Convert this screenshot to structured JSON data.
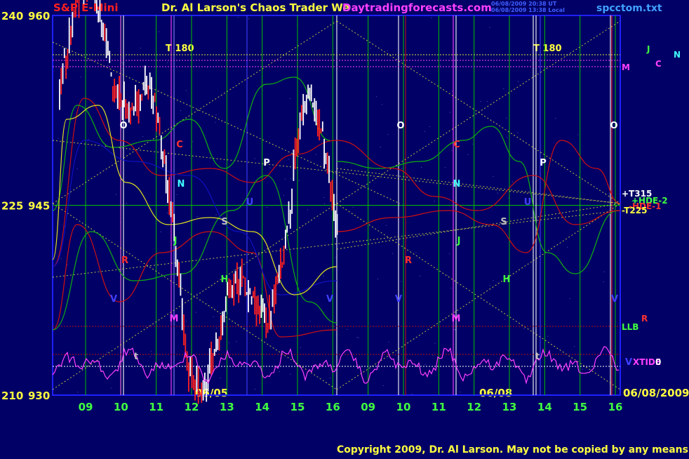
{
  "header": {
    "title_left": "S&P E-Mini",
    "title_center": "Dr. Al Larson's Chaos Trader We",
    "site": "Daytradingforecasts.com",
    "timestamp_1": "06/08/2009 20:38 UT",
    "timestamp_2": "06/08/2009 13:38 Local",
    "filename": "spcctom.txt"
  },
  "footer": {
    "copyright": "Copyright 2009, Dr. Al Larson. May not be copied by any means."
  },
  "colors": {
    "background": "#000066",
    "frame": "#2020ff",
    "grid": "#00c000",
    "price_up": "#ffffff",
    "price_down": "#ff2020",
    "red_line": "#d01010",
    "green_line": "#10b010",
    "blue_line": "#1010c0",
    "yellow_dot": "#e0e040",
    "magenta_line": "#ff40ff",
    "dark_red_dot": "#a01010"
  },
  "chart_data": {
    "type": "line",
    "instrument": "S&P E-Mini",
    "left_axis_outer": [
      {
        "label": "240",
        "value": 960
      },
      {
        "label": "225",
        "value": 945
      },
      {
        "label": "210",
        "value": 930
      }
    ],
    "ylim": [
      930,
      960
    ],
    "x_ticks": [
      "09",
      "10",
      "11",
      "12",
      "13",
      "14",
      "15",
      "16",
      "09",
      "10",
      "11",
      "12",
      "13",
      "14",
      "15",
      "16"
    ],
    "date_labels": [
      "06/05",
      "06/08",
      "06/08/2009"
    ],
    "right_labels": [
      {
        "text": "+T315",
        "color": "#ffffff"
      },
      {
        "text": "+HDE-2",
        "color": "#40ff40"
      },
      {
        "text": "-HDE-1",
        "color": "#ff3030"
      },
      {
        "text": "-T225",
        "color": "#ffff40"
      },
      {
        "text": "LLB",
        "color": "#40ff40"
      },
      {
        "text": "R",
        "color": "#ff3030"
      },
      {
        "text": "XTIDE",
        "color": "#ff40ff"
      },
      {
        "text": "0",
        "color": "#ffffff"
      },
      {
        "text": "M",
        "color": "#ff40ff"
      },
      {
        "text": "J",
        "color": "#40ff40"
      },
      {
        "text": "C",
        "color": "#ff40ff"
      },
      {
        "text": "N",
        "color": "#40ffff"
      }
    ],
    "time_lines": [
      {
        "text": "T 180",
        "color": "#ffff40"
      },
      {
        "text": "T 180",
        "color": "#ffff40"
      }
    ],
    "planet_markers": [
      {
        "text": "O",
        "color": "#ffffff"
      },
      {
        "text": "O",
        "color": "#ffffff"
      },
      {
        "text": "O",
        "color": "#ffffff"
      },
      {
        "text": "C",
        "color": "#ff3030"
      },
      {
        "text": "C",
        "color": "#ff3030"
      },
      {
        "text": "N",
        "color": "#40ffff"
      },
      {
        "text": "N",
        "color": "#40ffff"
      },
      {
        "text": "P",
        "color": "#ffffff"
      },
      {
        "text": "P",
        "color": "#ffffff"
      },
      {
        "text": "U",
        "color": "#4040ff"
      },
      {
        "text": "U",
        "color": "#4040ff"
      },
      {
        "text": "S",
        "color": "#c0c0c0"
      },
      {
        "text": "S",
        "color": "#c0c0c0"
      },
      {
        "text": "J",
        "color": "#40ff40"
      },
      {
        "text": "J",
        "color": "#40ff40"
      },
      {
        "text": "R",
        "color": "#ff3030"
      },
      {
        "text": "R",
        "color": "#ff3030"
      },
      {
        "text": "H",
        "color": "#40ff40"
      },
      {
        "text": "H",
        "color": "#40ff40"
      },
      {
        "text": "V",
        "color": "#4040ff"
      },
      {
        "text": "V",
        "color": "#4040ff"
      },
      {
        "text": "V",
        "color": "#4040ff"
      },
      {
        "text": "V",
        "color": "#4040ff"
      },
      {
        "text": "M",
        "color": "#ff40ff"
      },
      {
        "text": "M",
        "color": "#ff40ff"
      },
      {
        "text": "t",
        "color": "#c0c0c0"
      },
      {
        "text": "t",
        "color": "#c0c0c0"
      },
      {
        "text": "V",
        "color": "#4040ff"
      }
    ]
  }
}
